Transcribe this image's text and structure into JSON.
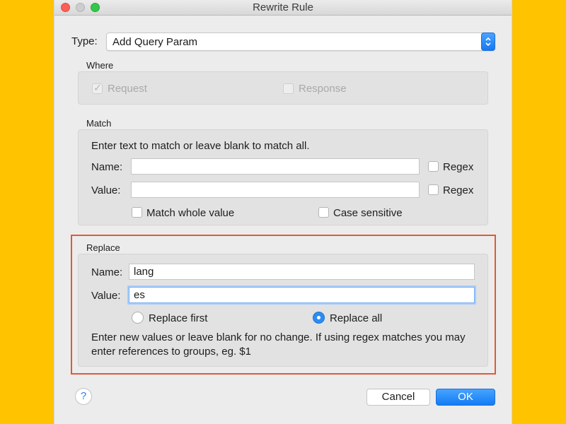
{
  "window": {
    "title": "Rewrite Rule"
  },
  "type": {
    "label": "Type:",
    "value": "Add Query Param"
  },
  "where": {
    "title": "Where",
    "request_label": "Request",
    "request_checked": true,
    "response_label": "Response",
    "response_checked": false
  },
  "match": {
    "title": "Match",
    "instruction": "Enter text to match or leave blank to match all.",
    "name_label": "Name:",
    "name_value": "",
    "value_label": "Value:",
    "value_value": "",
    "regex_label": "Regex",
    "match_whole_label": "Match whole value",
    "case_sensitive_label": "Case sensitive"
  },
  "replace": {
    "title": "Replace",
    "name_label": "Name:",
    "name_value": "lang",
    "value_label": "Value:",
    "value_value": "es",
    "replace_first_label": "Replace first",
    "replace_all_label": "Replace all",
    "selected": "Replace all",
    "note": "Enter new values or leave blank for no change. If using regex matches you may enter references to groups, eg. $1"
  },
  "footer": {
    "help": "?",
    "cancel": "Cancel",
    "ok": "OK"
  },
  "colors": {
    "background": "#FFC300",
    "highlight": "#e05a36",
    "accent": "#1878f0"
  },
  "icons": [
    "close-icon",
    "minimize-icon",
    "maximize-icon",
    "stepper-icon",
    "checkmark-icon",
    "help-icon"
  ]
}
